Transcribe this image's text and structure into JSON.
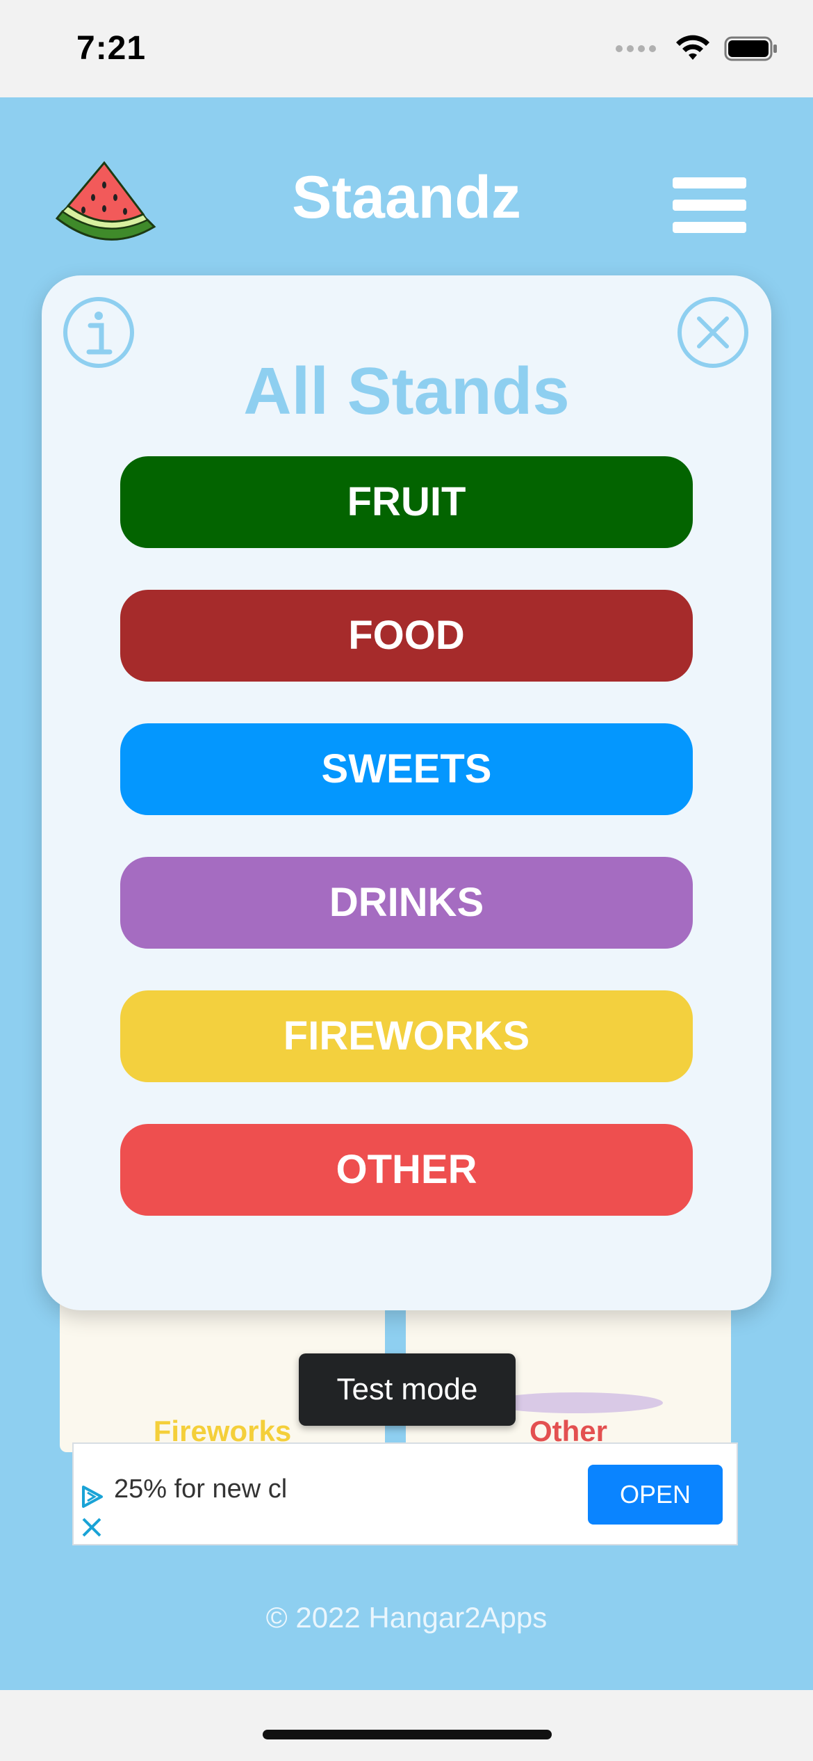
{
  "status_bar": {
    "time": "7:21",
    "icons": [
      "signal-dots-icon",
      "wifi-icon",
      "battery-icon"
    ]
  },
  "header": {
    "logo_icon": "watermelon-icon",
    "title": "Staandz",
    "menu_icon": "hamburger-menu-icon"
  },
  "background_cards": [
    {
      "label": "Fireworks",
      "color": "#f4cf3a"
    },
    {
      "label": "Other",
      "color": "#e35050"
    }
  ],
  "modal": {
    "info_icon": "info-icon",
    "close_icon": "close-icon",
    "title": "All Stands",
    "categories": [
      {
        "label": "FRUIT",
        "color": "#036400"
      },
      {
        "label": "FOOD",
        "color": "#a62b2b"
      },
      {
        "label": "SWEETS",
        "color": "#0497fe"
      },
      {
        "label": "DRINKS",
        "color": "#a56cc1"
      },
      {
        "label": "FIREWORKS",
        "color": "#f3d03e"
      },
      {
        "label": "OTHER",
        "color": "#ee4f4f"
      }
    ]
  },
  "ad": {
    "text": "25% for new cl",
    "open_label": "OPEN",
    "toast": "Test mode"
  },
  "footer": {
    "copyright": "© 2022 Hangar2Apps"
  },
  "colors": {
    "app_background": "#8ecff0",
    "modal_background": "#eef6fc",
    "title_color": "#8ecff0"
  }
}
